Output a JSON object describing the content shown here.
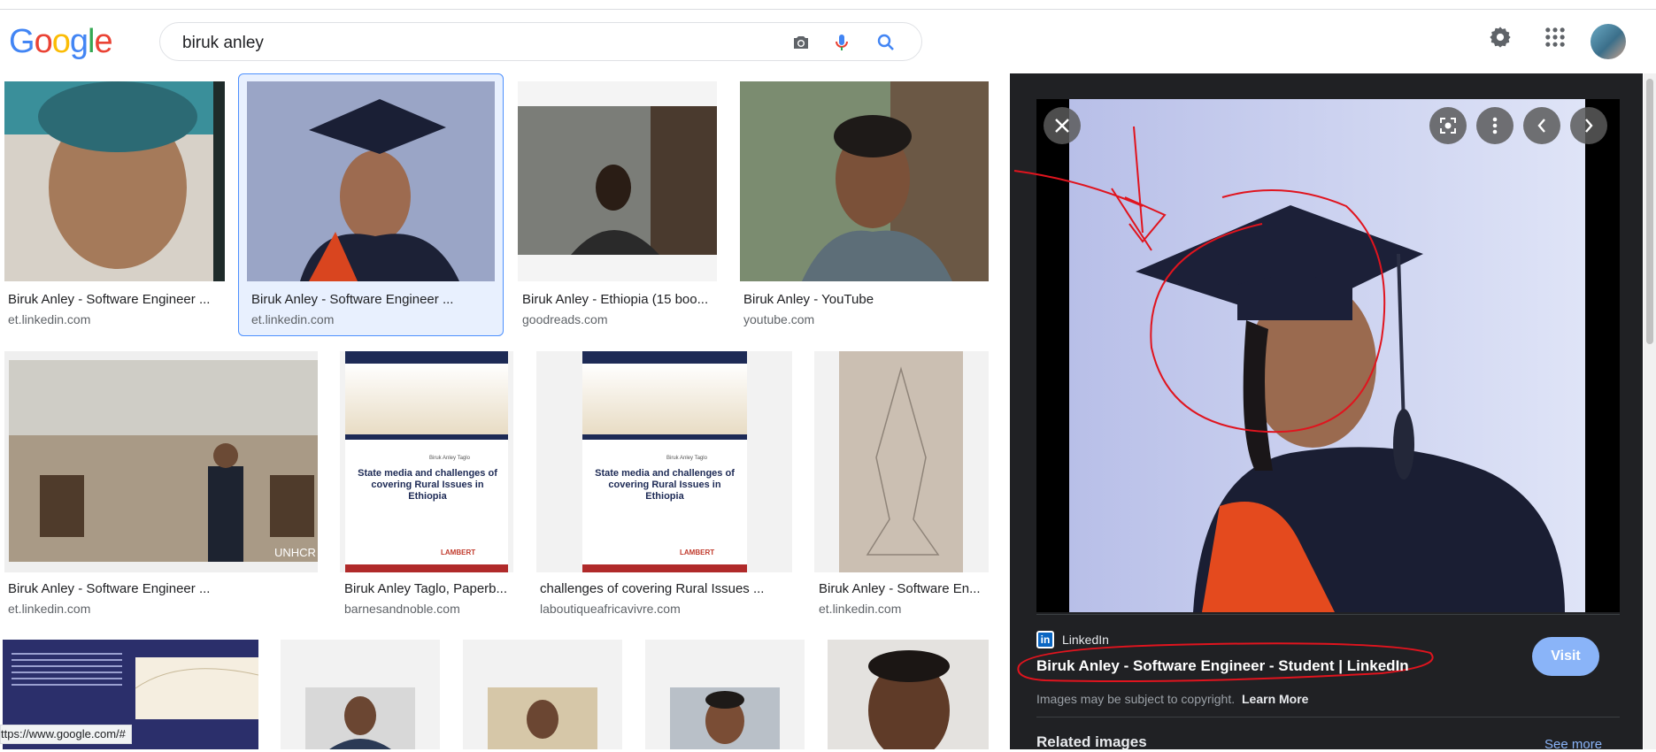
{
  "search": {
    "query": "biruk anley"
  },
  "status_bar": "ttps://www.google.com/#",
  "results": [
    {
      "title": "Biruk Anley - Software Engineer ...",
      "source": "et.linkedin.com"
    },
    {
      "title": "Biruk Anley - Software Engineer ...",
      "source": "et.linkedin.com"
    },
    {
      "title": "Biruk Anley - Ethiopia (15 boo...",
      "source": "goodreads.com"
    },
    {
      "title": "Biruk Anley - YouTube",
      "source": "youtube.com"
    },
    {
      "title": "Biruk Anley - Software Engineer ...",
      "source": "et.linkedin.com"
    },
    {
      "title": "Biruk Anley Taglo, Paperb...",
      "source": "barnesandnoble.com"
    },
    {
      "title": "challenges of covering Rural Issues ...",
      "source": "laboutiqueafricavivre.com"
    },
    {
      "title": "Biruk Anley - Software En...",
      "source": "et.linkedin.com"
    }
  ],
  "book_cover": {
    "author": "Biruk Anley Taglo",
    "title": "State media and challenges of covering Rural Issues in Ethiopia",
    "publisher": "LAMBERT"
  },
  "photo_watermark": "UNHCR",
  "preview": {
    "source_name": "LinkedIn",
    "source_icon_text": "in",
    "title": "Biruk Anley - Software Engineer - Student | LinkedIn",
    "visit_label": "Visit",
    "copyright_text": "Images may be subject to copyright.",
    "learn_more_label": "Learn More",
    "related_label": "Related images",
    "see_more_label": "See more"
  },
  "colors": {
    "google_blue": "#4285F4",
    "google_red": "#EA4335",
    "google_yellow": "#FBBC05",
    "google_green": "#34A853",
    "panel_bg": "#202124",
    "annotation_red": "#e0141e",
    "visit_button": "#8ab4f8"
  },
  "icons": [
    "camera-icon",
    "microphone-icon",
    "search-icon",
    "gear-icon",
    "apps-grid-icon",
    "close-icon",
    "lens-icon",
    "more-vert-icon",
    "chevron-left-icon",
    "chevron-right-icon"
  ]
}
